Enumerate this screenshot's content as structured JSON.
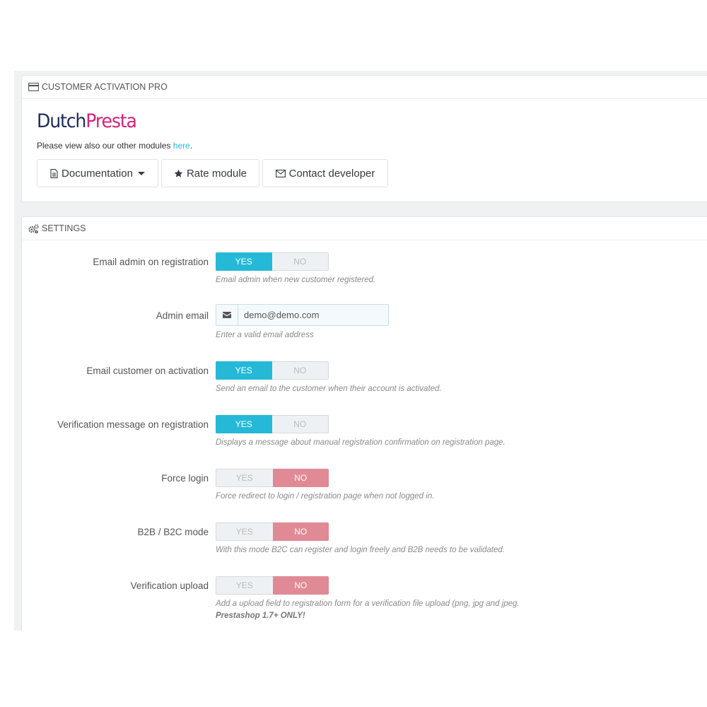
{
  "module_panel": {
    "heading": "CUSTOMER ACTIVATION PRO",
    "brand_part1": "Dutch",
    "brand_part2": "Presta",
    "intro_text": "Please view also our other modules ",
    "intro_link": "here",
    "intro_end": ".",
    "buttons": {
      "documentation": "Documentation",
      "rate": "Rate module",
      "contact": "Contact developer"
    }
  },
  "settings": {
    "heading": "SETTINGS",
    "yes_label": "YES",
    "no_label": "NO",
    "email_admin": {
      "label": "Email admin on registration",
      "value": "YES",
      "help": "Email admin when new customer registered."
    },
    "admin_email": {
      "label": "Admin email",
      "value": "demo@demo.com",
      "help": "Enter a valid email address"
    },
    "email_customer": {
      "label": "Email customer on activation",
      "value": "YES",
      "help": "Send an email to the customer when their account is activated."
    },
    "verification_message": {
      "label": "Verification message on registration",
      "value": "YES",
      "help": "Displays a message about manual registration confirmation on registration page."
    },
    "force_login": {
      "label": "Force login",
      "value": "NO",
      "help": "Force redirect to login / registration page when not logged in."
    },
    "b2b_mode": {
      "label": "B2B / B2C mode",
      "value": "NO",
      "help": "With this mode B2C can register and login freely and B2B needs to be validated."
    },
    "verification_upload": {
      "label": "Verification upload",
      "value": "NO",
      "help": "Add a upload field to registration form for a verification file upload (png, jpg and jpeg.",
      "note": "Prestashop 1.7+ ONLY!"
    }
  },
  "colors": {
    "accent": "#25b9d7",
    "danger": "#e08a95",
    "brand_dark": "#1d2b5a",
    "brand_pink": "#d6237a"
  }
}
